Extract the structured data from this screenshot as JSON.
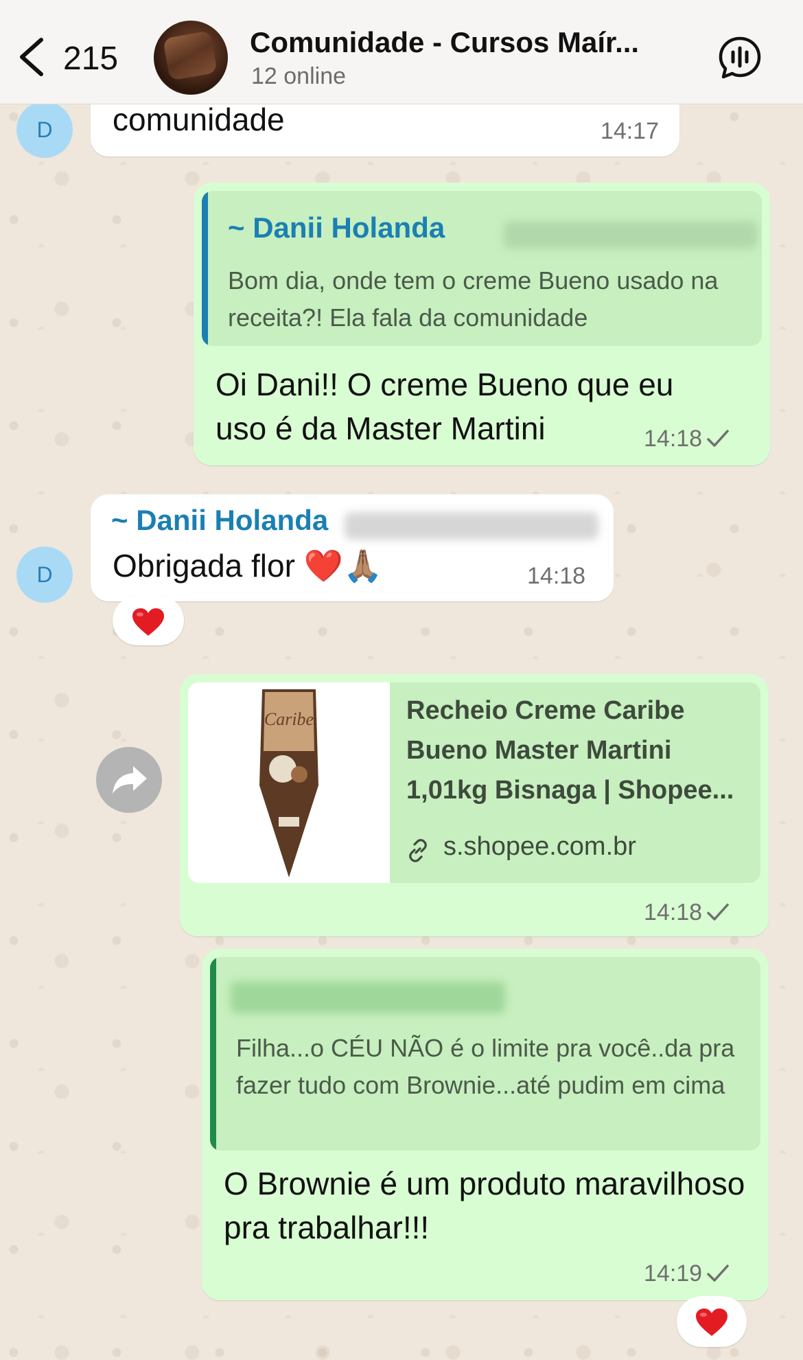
{
  "header": {
    "back_count": "215",
    "title": "Comunidade - Cursos Maír...",
    "subtitle": "12 online"
  },
  "colors": {
    "outgoing_bubble": "#d9fdd3",
    "incoming_bubble": "#ffffff",
    "sender_name": "#1b7fb3",
    "quote_bar_blue": "#1b7fb3",
    "quote_bar_green": "#1f8a4c"
  },
  "icons": {
    "back": "chevron-left-icon",
    "voice_chat": "voice-chat-icon",
    "forward": "forward-arrow-icon",
    "link": "link-icon",
    "check": "single-check-icon",
    "heart": "red-heart-emoji",
    "pray": "praying-hands-emoji"
  },
  "messages": {
    "m1": {
      "avatar_letter": "D",
      "text": "comunidade",
      "time": "14:17"
    },
    "m2": {
      "quote_sender": "~ Danii Holanda",
      "quote_text": "Bom dia, onde tem o creme Bueno usado na receita?! Ela fala da comunidade",
      "text": "Oi Dani!! O creme Bueno que eu uso é da Master Martini",
      "time": "14:18"
    },
    "m3": {
      "avatar_letter": "D",
      "sender": "~ Danii Holanda",
      "text": "Obrigada flor ❤️🙏🏽",
      "time": "14:18",
      "reaction": "❤️"
    },
    "m4": {
      "link_title": "Recheio Creme Caribe Bueno Master Martini 1,01kg Bisnaga | Shopee...",
      "link_domain": "s.shopee.com.br",
      "product_label": "Caribe",
      "time": "14:18"
    },
    "m5": {
      "quote_text": "Filha...o CÉU NÃO é o limite pra você..da pra fazer tudo com Brownie...até pudim em cima",
      "text": "O Brownie é um produto maravilhoso pra trabalhar!!!",
      "time": "14:19",
      "reaction": "❤️"
    }
  }
}
